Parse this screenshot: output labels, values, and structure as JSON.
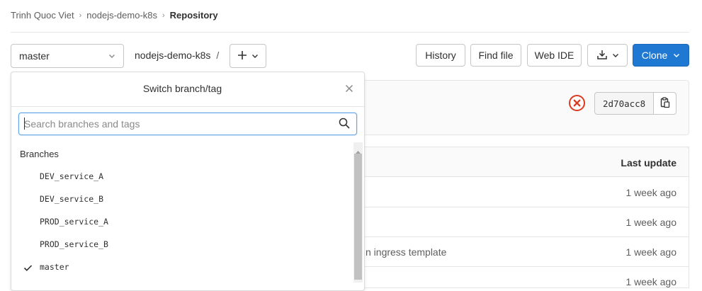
{
  "breadcrumb": {
    "items": [
      "Trinh Quoc Viet",
      "nodejs-demo-k8s"
    ],
    "current": "Repository"
  },
  "toolbar": {
    "branch": "master",
    "repo_path": "nodejs-demo-k8s",
    "path_sep": "/",
    "buttons": {
      "history": "History",
      "find_file": "Find file",
      "web_ide": "Web IDE",
      "clone": "Clone"
    }
  },
  "commit": {
    "sha": "2d70acc8",
    "pipeline_status_color": "#db3b21"
  },
  "table": {
    "header_last_update": "Last update",
    "rows": [
      {
        "message": "",
        "date": "1 week ago"
      },
      {
        "message": "",
        "date": "1 week ago"
      },
      {
        "message": "n ingress template",
        "date": "1 week ago"
      },
      {
        "message": "",
        "date": "1 week ago"
      }
    ]
  },
  "dropdown": {
    "title": "Switch branch/tag",
    "search_placeholder": "Search branches and tags",
    "section": "Branches",
    "branches": [
      {
        "name": "DEV_service_A",
        "selected": false
      },
      {
        "name": "DEV_service_B",
        "selected": false
      },
      {
        "name": "PROD_service_A",
        "selected": false
      },
      {
        "name": "PROD_service_B",
        "selected": false
      },
      {
        "name": "master",
        "selected": true
      }
    ]
  },
  "colors": {
    "accent": "#1f78d1",
    "focus_border": "#63a6e9"
  }
}
